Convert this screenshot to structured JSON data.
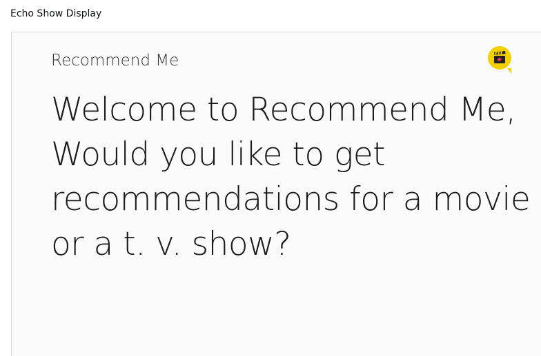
{
  "window": {
    "title": "Echo Show Display"
  },
  "display": {
    "skill_title": "Recommend Me",
    "skill_logo_icon": "clapperboard-icon",
    "primary_text": "Welcome to Recommend Me, Would you like to get recommendations for a movie or a t. v. show?"
  },
  "colors": {
    "logo_background": "#f5d000",
    "display_background": "#fbfbfb"
  }
}
